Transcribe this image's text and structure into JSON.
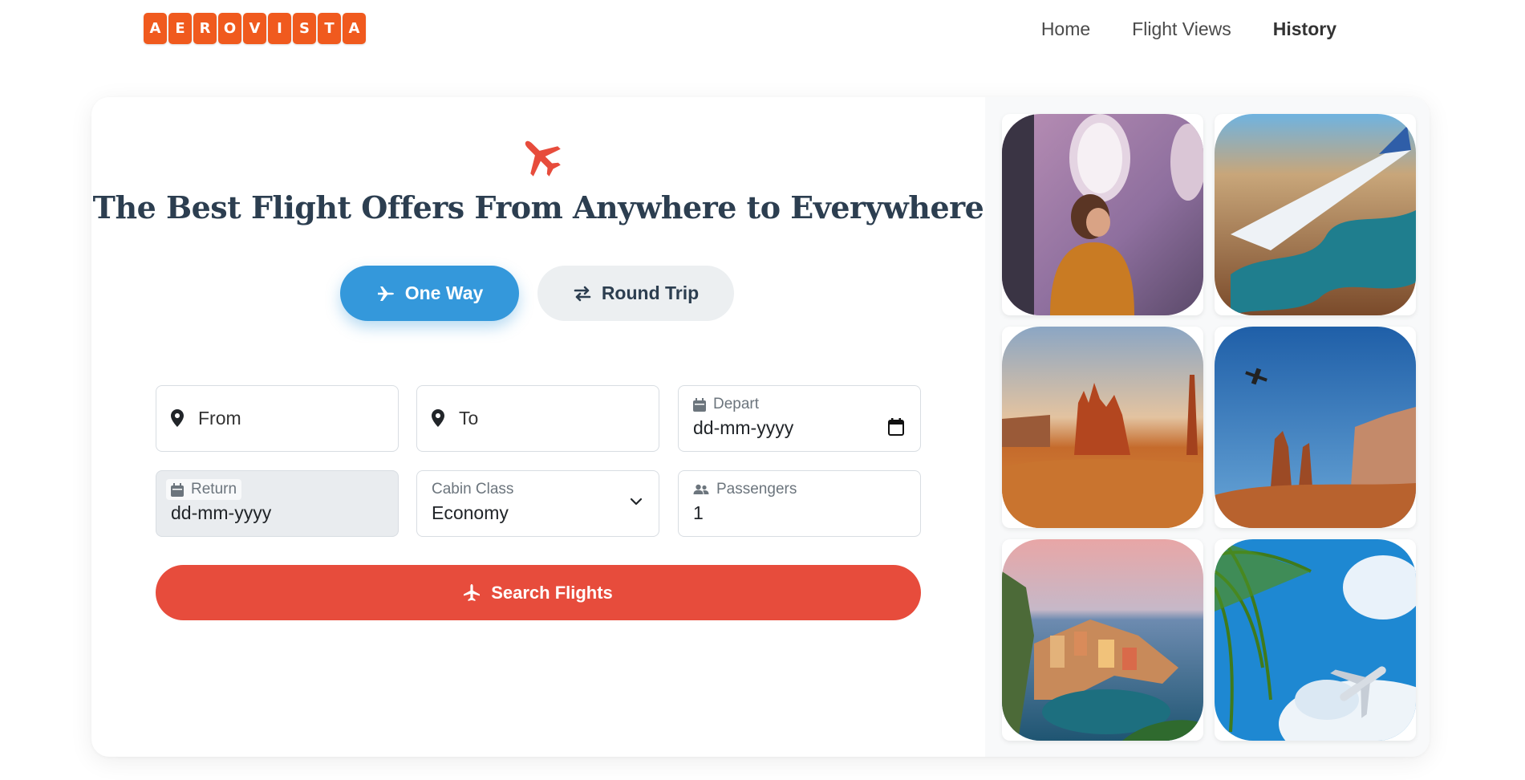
{
  "brand": {
    "letters": [
      "A",
      "E",
      "R",
      "O",
      "V",
      "I",
      "S",
      "T",
      "A"
    ],
    "color": "#f05a1e"
  },
  "nav": {
    "items": [
      {
        "label": "Home"
      },
      {
        "label": "Flight Views"
      },
      {
        "label": "History"
      }
    ]
  },
  "hero": {
    "headline": "The Best Flight Offers From Anywhere to Everywhere",
    "icon": "plane-icon"
  },
  "trip_type": {
    "one_way": "One Way",
    "round_trip": "Round Trip",
    "selected": "One Way"
  },
  "form": {
    "from_placeholder": "From",
    "to_placeholder": "To",
    "depart_label": "Depart",
    "depart_value": "dd-mm-yyyy",
    "return_label": "Return",
    "return_value": "dd-mm-yyyy",
    "cabin_label": "Cabin Class",
    "cabin_value": "Economy",
    "passengers_label": "Passengers",
    "passengers_value": "1"
  },
  "search_button": "Search Flights",
  "colors": {
    "primary": "#3498db",
    "accent": "#e74c3c",
    "heading": "#2c3e50"
  },
  "gallery": [
    {
      "subject": "girl-at-airplane-window"
    },
    {
      "subject": "airplane-wing-over-canyon"
    },
    {
      "subject": "desert-rock-formations"
    },
    {
      "subject": "plane-over-desert-buttes"
    },
    {
      "subject": "coastal-village-harbor"
    },
    {
      "subject": "palm-leaves-and-airplane"
    }
  ]
}
